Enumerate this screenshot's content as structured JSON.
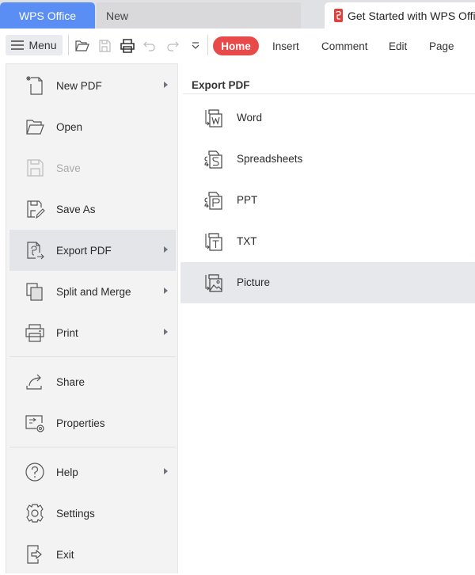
{
  "tabs": [
    {
      "label": "WPS Office",
      "active": true
    },
    {
      "label": "New"
    },
    {
      "label": "Get Started with WPS Office",
      "icon": "pdf-icon"
    }
  ],
  "toolbar": {
    "menu_label": "Menu",
    "quick_icons": [
      "open-folder-icon",
      "save-icon",
      "print-icon",
      "undo-icon",
      "redo-icon",
      "customize-dropdown-icon"
    ],
    "ribbon_tabs": [
      {
        "label": "Home",
        "active": true
      },
      {
        "label": "Insert"
      },
      {
        "label": "Comment"
      },
      {
        "label": "Edit"
      },
      {
        "label": "Page"
      }
    ]
  },
  "menu": {
    "items": [
      {
        "label": "New PDF",
        "icon": "new-pdf-icon",
        "submenu": true
      },
      {
        "label": "Open",
        "icon": "open-folder-icon"
      },
      {
        "label": "Save",
        "icon": "save-icon",
        "disabled": true
      },
      {
        "label": "Save As",
        "icon": "save-as-icon"
      },
      {
        "label": "Export PDF",
        "icon": "export-pdf-icon",
        "submenu": true,
        "active": true
      },
      {
        "label": "Split and Merge",
        "icon": "split-merge-icon",
        "submenu": true
      },
      {
        "label": "Print",
        "icon": "print-icon",
        "submenu": true
      },
      {
        "label": "Share",
        "icon": "share-icon"
      },
      {
        "label": "Properties",
        "icon": "properties-icon"
      },
      {
        "label": "Help",
        "icon": "help-icon",
        "submenu": true
      },
      {
        "label": "Settings",
        "icon": "settings-icon"
      },
      {
        "label": "Exit",
        "icon": "exit-icon"
      }
    ]
  },
  "submenu": {
    "title": "Export PDF",
    "items": [
      {
        "label": "Word",
        "icon": "export-word-icon"
      },
      {
        "label": "Spreadsheets",
        "icon": "export-spreadsheet-icon"
      },
      {
        "label": "PPT",
        "icon": "export-ppt-icon"
      },
      {
        "label": "TXT",
        "icon": "export-txt-icon"
      },
      {
        "label": "Picture",
        "icon": "export-picture-icon",
        "active": true
      }
    ]
  },
  "colors": {
    "brand_tab": "#5b8ef5",
    "home_tab": "#e84a4a",
    "pdf_badge": "#e0413d",
    "menu_bg": "#f3f3f3",
    "active_item_bg": "#e3e5e8"
  }
}
